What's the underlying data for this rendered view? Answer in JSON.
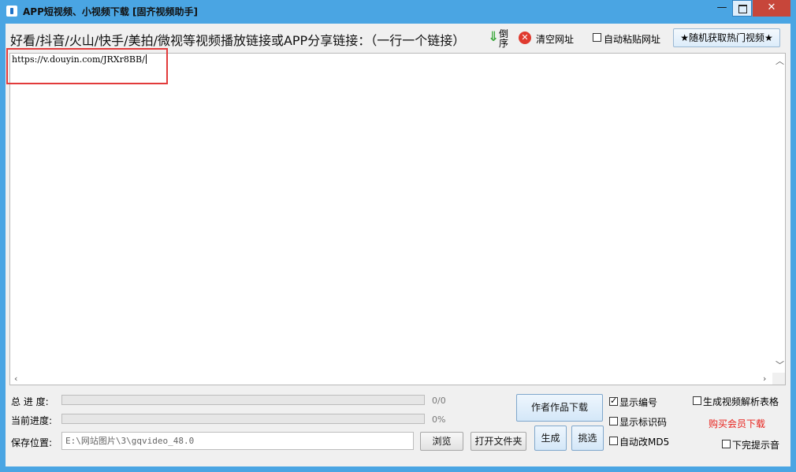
{
  "window": {
    "title": "APP短视频、小视频下载 [固齐视频助手]",
    "minimize_glyph": "—",
    "close_glyph": "✕",
    "accent_color": "#4aa5e3"
  },
  "toolbar": {
    "instruction": "好看/抖音/火山/快手/美拍/微视等视频播放链接或APP分享链接：（一行一个链接）",
    "reverse_label": "倒序",
    "reverse_icon_glyph": "⇓",
    "clear_label": "清空网址",
    "clear_icon_glyph": "✕",
    "auto_paste_label": "自动粘贴网址",
    "auto_paste_checked": false,
    "hot_videos_button": "★随机获取热门视频★"
  },
  "editor": {
    "content": "https://v.douyin.com/JRXr8BB/"
  },
  "progress": {
    "total_label": "总 进 度:",
    "total_value": 0,
    "total_text": "0/0",
    "current_label": "当前进度:",
    "current_value": 0,
    "current_text": "0%"
  },
  "save": {
    "label": "保存位置:",
    "path": "E:\\网站图片\\3\\gqvideo_48.0",
    "browse_button": "浏览",
    "open_folder_button": "打开文件夹"
  },
  "actions": {
    "author_download_button": "作者作品下载",
    "generate_button": "生成",
    "pick_button": "挑选"
  },
  "options": {
    "show_number_label": "显示编号",
    "show_number_checked": true,
    "show_id_label": "显示标识码",
    "show_id_checked": false,
    "auto_md5_label": "自动改MD5",
    "auto_md5_checked": false,
    "gen_table_label": "生成视频解析表格",
    "gen_table_checked": false,
    "buy_member_label": "购买会员下载",
    "done_sound_label": "下完提示音",
    "done_sound_checked": false
  }
}
